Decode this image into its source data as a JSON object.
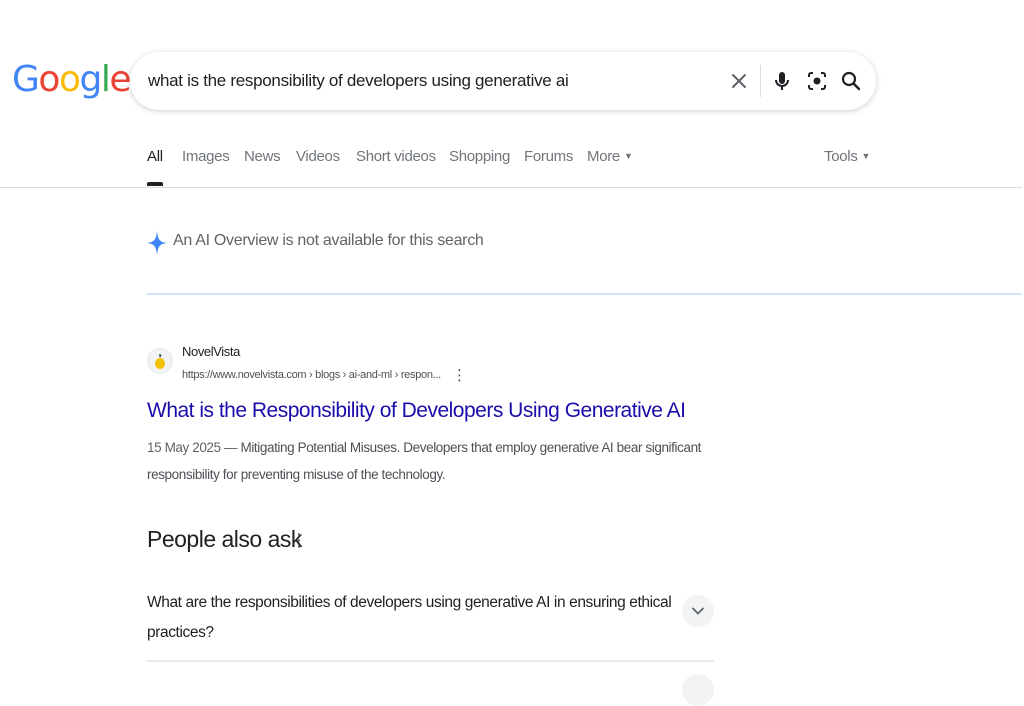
{
  "logo": {
    "letters": [
      "G",
      "o",
      "o",
      "g",
      "l",
      "e"
    ],
    "colors": [
      "#4285f4",
      "#ea4335",
      "#fbbc05",
      "#4285f4",
      "#34a853",
      "#ea4335"
    ]
  },
  "search": {
    "query": "what is the responsibility of developers using generative ai",
    "icons": [
      "close-icon",
      "microphone-icon",
      "lens-icon",
      "search-icon"
    ]
  },
  "tabs": {
    "items": [
      "All",
      "Images",
      "News",
      "Videos",
      "Short videos",
      "Shopping",
      "Forums",
      "More"
    ],
    "active": "All",
    "tools": "Tools"
  },
  "ai_overview": {
    "text": "An AI Overview is not available for this search",
    "icon": "sparkle-icon",
    "color": "#4285f4"
  },
  "result": {
    "site_name": "NovelVista",
    "url": "https://www.novelvista.com › blogs › ai-and-ml › respon...",
    "title": "What is the Responsibility of Developers Using Generative AI",
    "date": "15 May 2025 — ",
    "snippet": "Mitigating Potential Misuses. Developers that employ generative AI bear significant responsibility for preventing misuse of the technology.",
    "title_color": "#1a0dab"
  },
  "people_also_ask": {
    "title": "People also ask",
    "questions": [
      "What are the responsibilities of developers using generative AI in ensuring ethical practices?"
    ]
  }
}
